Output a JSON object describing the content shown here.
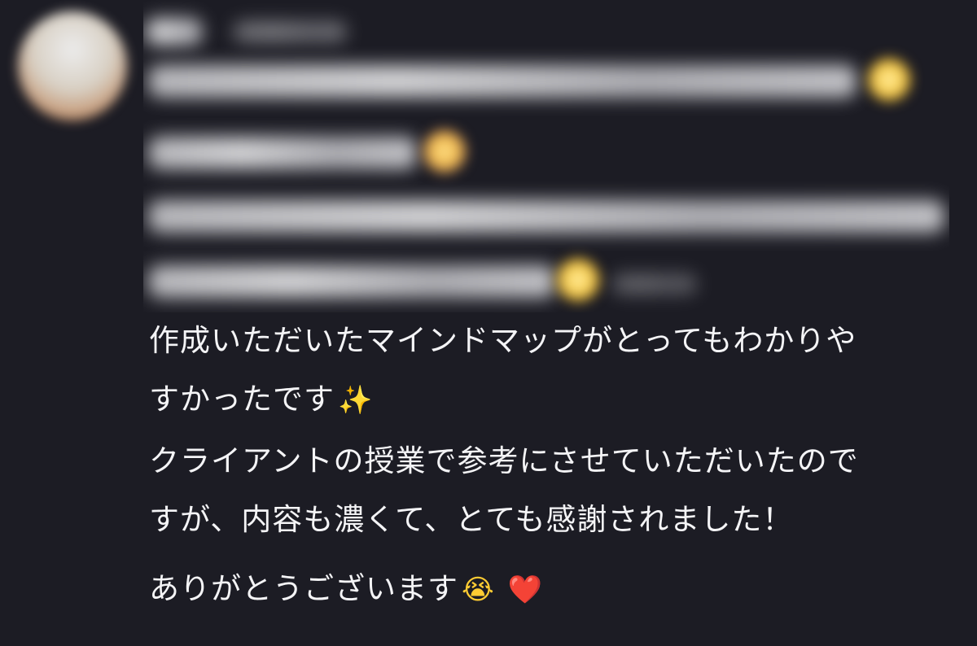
{
  "colors": {
    "background": "#1c1c24",
    "text": "#f4f4f6",
    "heart": "#e0222e"
  },
  "message": {
    "lines": [
      "作成いただいたマインドマップがとってもわかりや",
      "すかったです",
      "クライアントの授業で参考にさせていただいたので",
      "すが、内容も濃くて、とても感謝されました！",
      "ありがとうございます"
    ],
    "emojis": {
      "sparkles": "✨",
      "crying": "😭",
      "heart": "❤️"
    }
  }
}
